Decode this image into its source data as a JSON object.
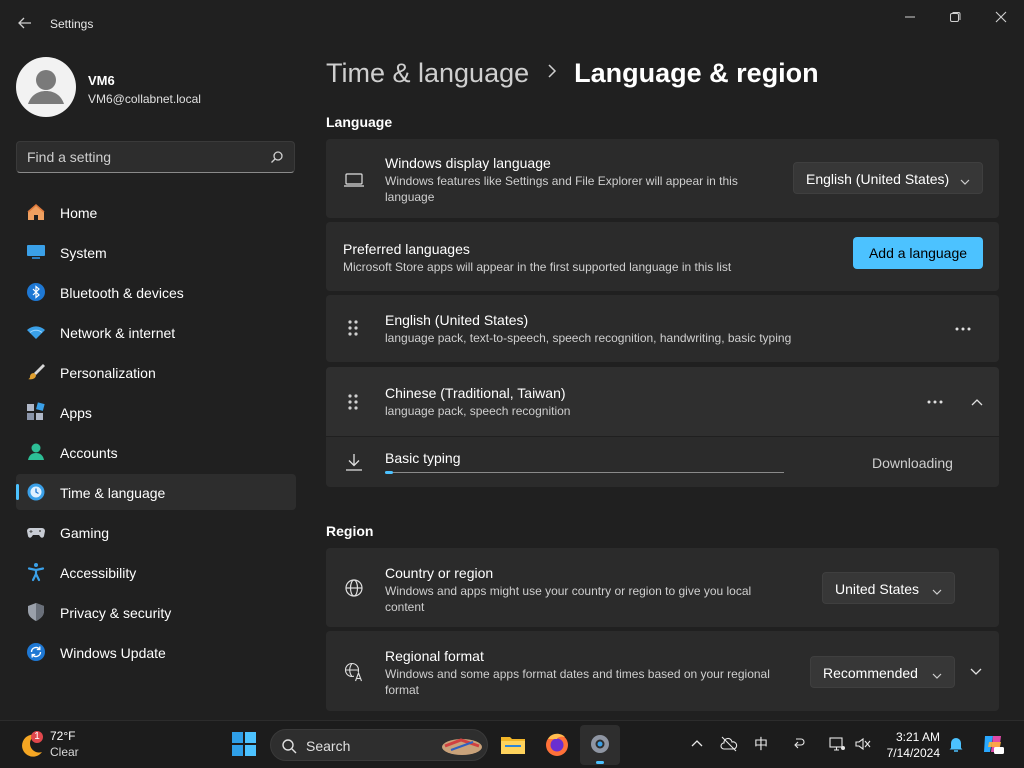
{
  "window": {
    "title": "Settings"
  },
  "profile": {
    "name": "VM6",
    "email": "VM6@collabnet.local"
  },
  "search": {
    "placeholder": "Find a setting"
  },
  "sidebar": {
    "items": [
      {
        "label": "Home",
        "icon": "home-icon"
      },
      {
        "label": "System",
        "icon": "system-icon"
      },
      {
        "label": "Bluetooth & devices",
        "icon": "bluetooth-icon"
      },
      {
        "label": "Network & internet",
        "icon": "wifi-icon"
      },
      {
        "label": "Personalization",
        "icon": "brush-icon"
      },
      {
        "label": "Apps",
        "icon": "apps-icon"
      },
      {
        "label": "Accounts",
        "icon": "accounts-icon"
      },
      {
        "label": "Time & language",
        "icon": "time-language-icon",
        "active": true
      },
      {
        "label": "Gaming",
        "icon": "gamepad-icon"
      },
      {
        "label": "Accessibility",
        "icon": "accessibility-icon"
      },
      {
        "label": "Privacy & security",
        "icon": "shield-icon"
      },
      {
        "label": "Windows Update",
        "icon": "update-icon"
      }
    ]
  },
  "breadcrumb": {
    "parent": "Time & language",
    "current": "Language & region"
  },
  "language_section": {
    "heading": "Language",
    "display_language": {
      "title": "Windows display language",
      "description": "Windows features like Settings and File Explorer will appear in this language",
      "value": "English (United States)"
    },
    "preferred": {
      "title": "Preferred languages",
      "description": "Microsoft Store apps will appear in the first supported language in this list",
      "button": "Add a language"
    },
    "languages": [
      {
        "name": "English (United States)",
        "features": "language pack, text-to-speech, speech recognition, handwriting, basic typing"
      },
      {
        "name": "Chinese (Traditional, Taiwan)",
        "features": "language pack, speech recognition"
      }
    ],
    "download": {
      "title": "Basic typing",
      "status": "Downloading",
      "progress": 0.02
    }
  },
  "region_section": {
    "heading": "Region",
    "country": {
      "title": "Country or region",
      "description": "Windows and apps might use your country or region to give you local content",
      "value": "United States"
    },
    "format": {
      "title": "Regional format",
      "description": "Windows and some apps format dates and times based on your regional format",
      "value": "Recommended"
    }
  },
  "taskbar": {
    "weather_temp": "72°F",
    "weather_condition": "Clear",
    "weather_badge": "1",
    "search_label": "Search",
    "clock_time": "3:21 AM",
    "clock_date": "7/14/2024",
    "ime": "中"
  },
  "colors": {
    "accent": "#4cc2ff",
    "background": "#202020",
    "card": "#2b2b2b"
  }
}
